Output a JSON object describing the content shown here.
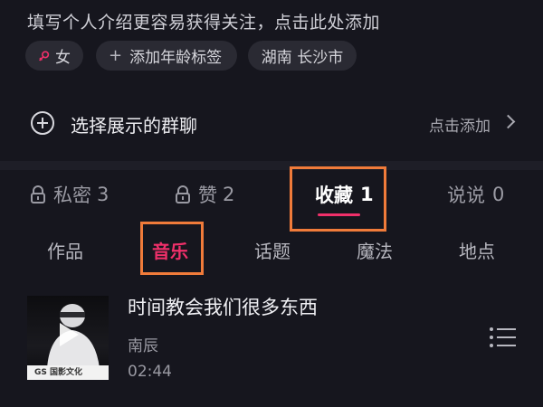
{
  "profile": {
    "intro_prompt": "填写个人介绍更容易获得关注，点击此处添加",
    "tags": {
      "gender": "女",
      "add_age": "添加年龄标签",
      "add_age_prefix": "+",
      "location": "湖南 长沙市"
    },
    "gender_icon": "female-icon",
    "gender_icon_color": "#f0306a"
  },
  "group_chat": {
    "title": "选择展示的群聊",
    "action": "点击添加",
    "icon": "circle-plus-icon"
  },
  "tabs": [
    {
      "label": "私密",
      "count": "3",
      "locked": true
    },
    {
      "label": "赞",
      "count": "2",
      "locked": true
    },
    {
      "label": "收藏",
      "count": "1",
      "locked": false,
      "active": true
    },
    {
      "label": "说说",
      "count": "0",
      "locked": false
    }
  ],
  "subtabs": [
    {
      "label": "作品"
    },
    {
      "label": "音乐",
      "active": true
    },
    {
      "label": "话题"
    },
    {
      "label": "魔法"
    },
    {
      "label": "地点"
    }
  ],
  "music_item": {
    "title": "时间教会我们很多东西",
    "artist": "南辰",
    "duration": "02:44",
    "cover_logo_text": "GS 国影文化"
  },
  "colors": {
    "accent": "#f0306a",
    "highlight_box": "#f07b3a",
    "background": "#16161e"
  }
}
